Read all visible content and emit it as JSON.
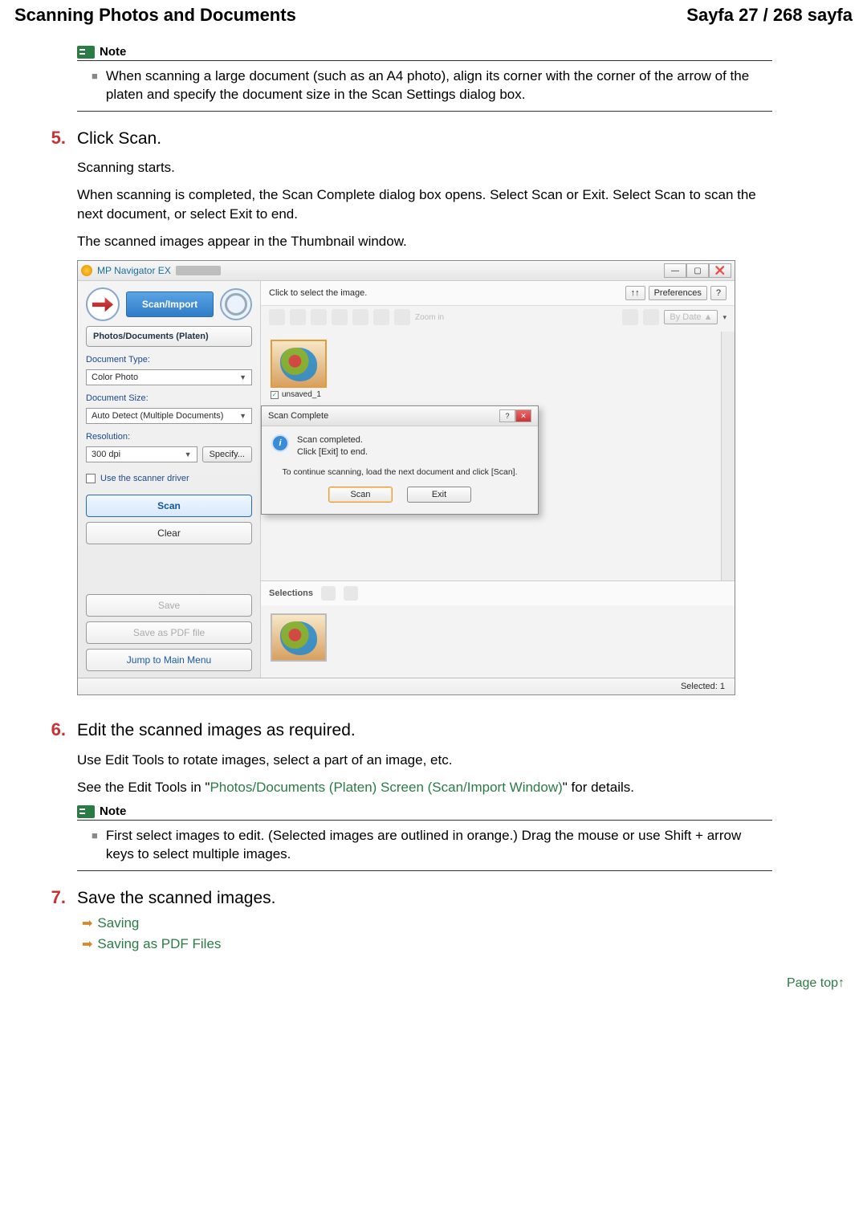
{
  "header": {
    "title_left": "Scanning Photos and Documents",
    "title_right": "Sayfa 27 / 268 sayfa"
  },
  "notes": {
    "label": "Note",
    "n1": "When scanning a large document (such as an A4 photo), align its corner with the corner of the arrow of the platen and specify the document size in the Scan Settings dialog box.",
    "n2": "First select images to edit. (Selected images are outlined in orange.) Drag the mouse or use Shift + arrow keys to select multiple images."
  },
  "steps": {
    "s5": {
      "num": "5.",
      "title": "Click Scan.",
      "p1": "Scanning starts.",
      "p2": "When scanning is completed, the Scan Complete dialog box opens. Select Scan or Exit. Select Scan to scan the next document, or select Exit to end.",
      "p3": "The scanned images appear in the Thumbnail window."
    },
    "s6": {
      "num": "6.",
      "title": "Edit the scanned images as required.",
      "p1": "Use Edit Tools to rotate images, select a part of an image, etc.",
      "p2a": "See the Edit Tools in \"",
      "link": "Photos/Documents (Platen) Screen (Scan/Import Window)",
      "p2b": "\" for details."
    },
    "s7": {
      "num": "7.",
      "title": "Save the scanned images.",
      "link1": "Saving",
      "link2": "Saving as PDF Files"
    }
  },
  "page_top": "Page top",
  "app": {
    "title": "MP Navigator EX",
    "window": {
      "min": "—",
      "max": "▢",
      "close": "❌"
    },
    "topbar": {
      "hint": "Click to select the image.",
      "guide_btn": "↑↑",
      "pref_btn": "Preferences",
      "help_btn": "?",
      "sort": "By Date ▲"
    },
    "left": {
      "scan_import": "Scan/Import",
      "tab": "Photos/Documents (Platen)",
      "doc_type_lbl": "Document Type:",
      "doc_type_val": "Color Photo",
      "doc_size_lbl": "Document Size:",
      "doc_size_val": "Auto Detect (Multiple Documents)",
      "res_lbl": "Resolution:",
      "res_val": "300 dpi",
      "specify": "Specify...",
      "use_driver": "Use the scanner driver",
      "scan_btn": "Scan",
      "clear_btn": "Clear",
      "save_btn": "Save",
      "save_pdf_btn": "Save as PDF file",
      "jump_btn": "Jump to Main Menu"
    },
    "thumb": {
      "name": "unsaved_1",
      "checked": "✓"
    },
    "zoom_lbl": "Zoom in",
    "selections_lbl": "Selections",
    "status": "Selected: 1",
    "dialog": {
      "title": "Scan Complete",
      "l1": "Scan completed.",
      "l2": "Click [Exit] to end.",
      "sub": "To continue scanning, load the next document and click [Scan].",
      "scan": "Scan",
      "exit": "Exit"
    }
  }
}
